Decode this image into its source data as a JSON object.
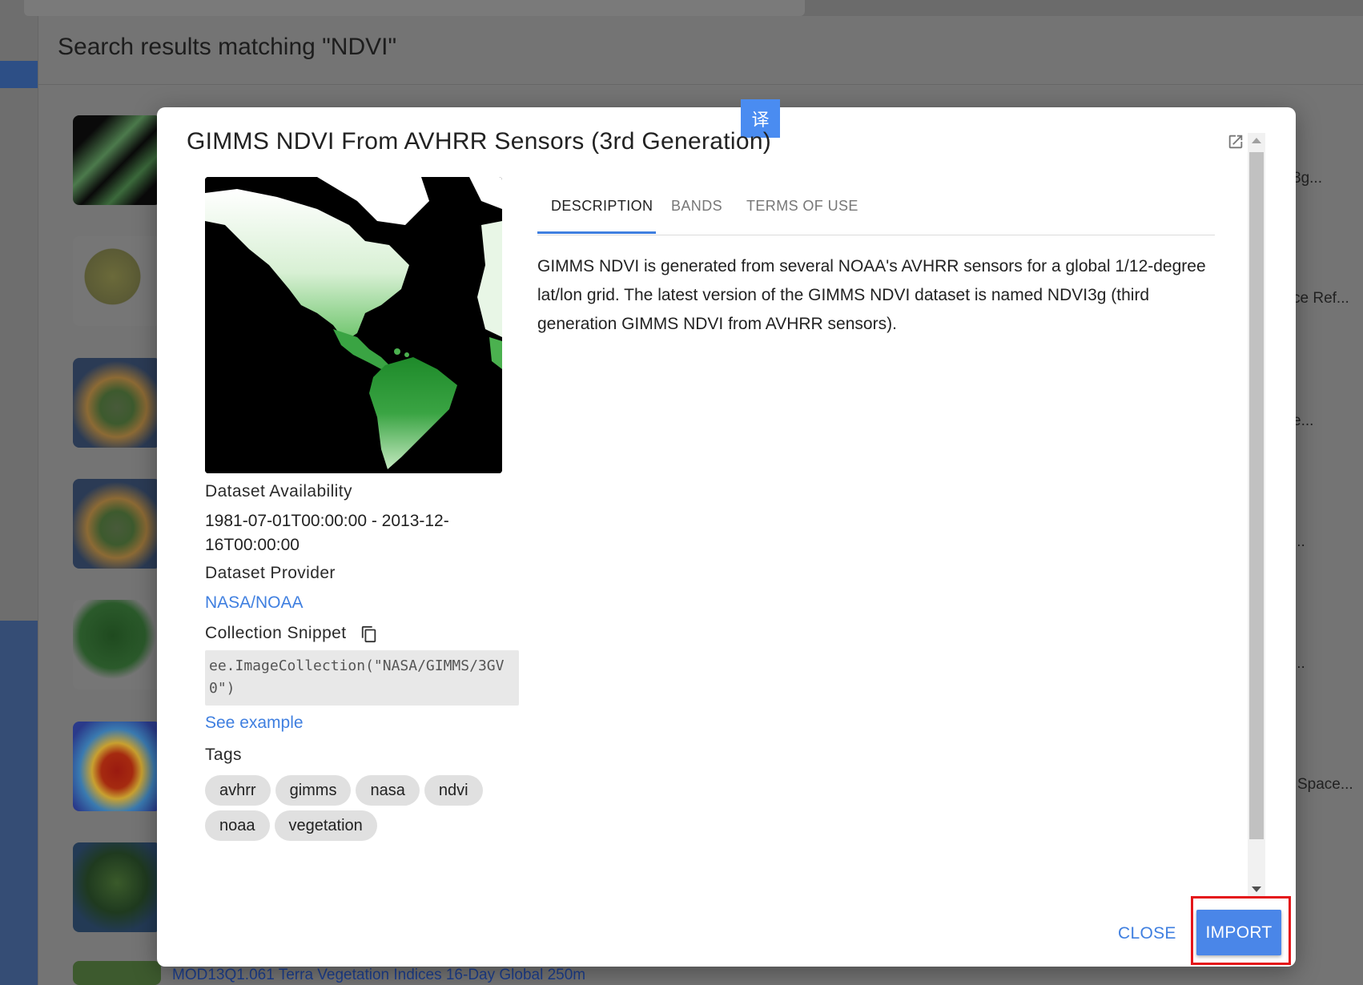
{
  "background": {
    "results_title": "Search results matching \"NDVI\"",
    "side_snippets": [
      "3g...",
      "ce Ref...",
      "e...",
      "...",
      "...",
      "Space..."
    ],
    "bottom_link": "MOD13Q1.061 Terra Vegetation Indices 16-Day Global 250m"
  },
  "translate_badge": "译",
  "modal": {
    "title": "GIMMS NDVI From AVHRR Sensors (3rd Generation)",
    "tabs": [
      {
        "label": "DESCRIPTION",
        "active": true
      },
      {
        "label": "BANDS",
        "active": false
      },
      {
        "label": "TERMS OF USE",
        "active": false
      }
    ],
    "description": "GIMMS NDVI is generated from several NOAA's AVHRR sensors for a global 1/12-degree lat/lon grid. The latest version of the GIMMS NDVI dataset is named NDVI3g (third generation GIMMS NDVI from AVHRR sensors).",
    "availability_label": "Dataset Availability",
    "availability_value": "1981-07-01T00:00:00 - 2013-12-16T00:00:00",
    "provider_label": "Dataset Provider",
    "provider_value": "NASA/NOAA",
    "snippet_label": "Collection Snippet",
    "snippet_code": "ee.ImageCollection(\"NASA/GIMMS/3GV0\")",
    "see_example": "See example",
    "tags_label": "Tags",
    "tags": [
      "avhrr",
      "gimms",
      "nasa",
      "ndvi",
      "noaa",
      "vegetation"
    ],
    "close_label": "CLOSE",
    "import_label": "IMPORT"
  },
  "colors": {
    "accent": "#3f7fe0",
    "import_button": "#4a86e8",
    "highlight_border": "#e4161a"
  },
  "icons": [
    "open-in-new-icon",
    "copy-icon",
    "translate-icon"
  ]
}
